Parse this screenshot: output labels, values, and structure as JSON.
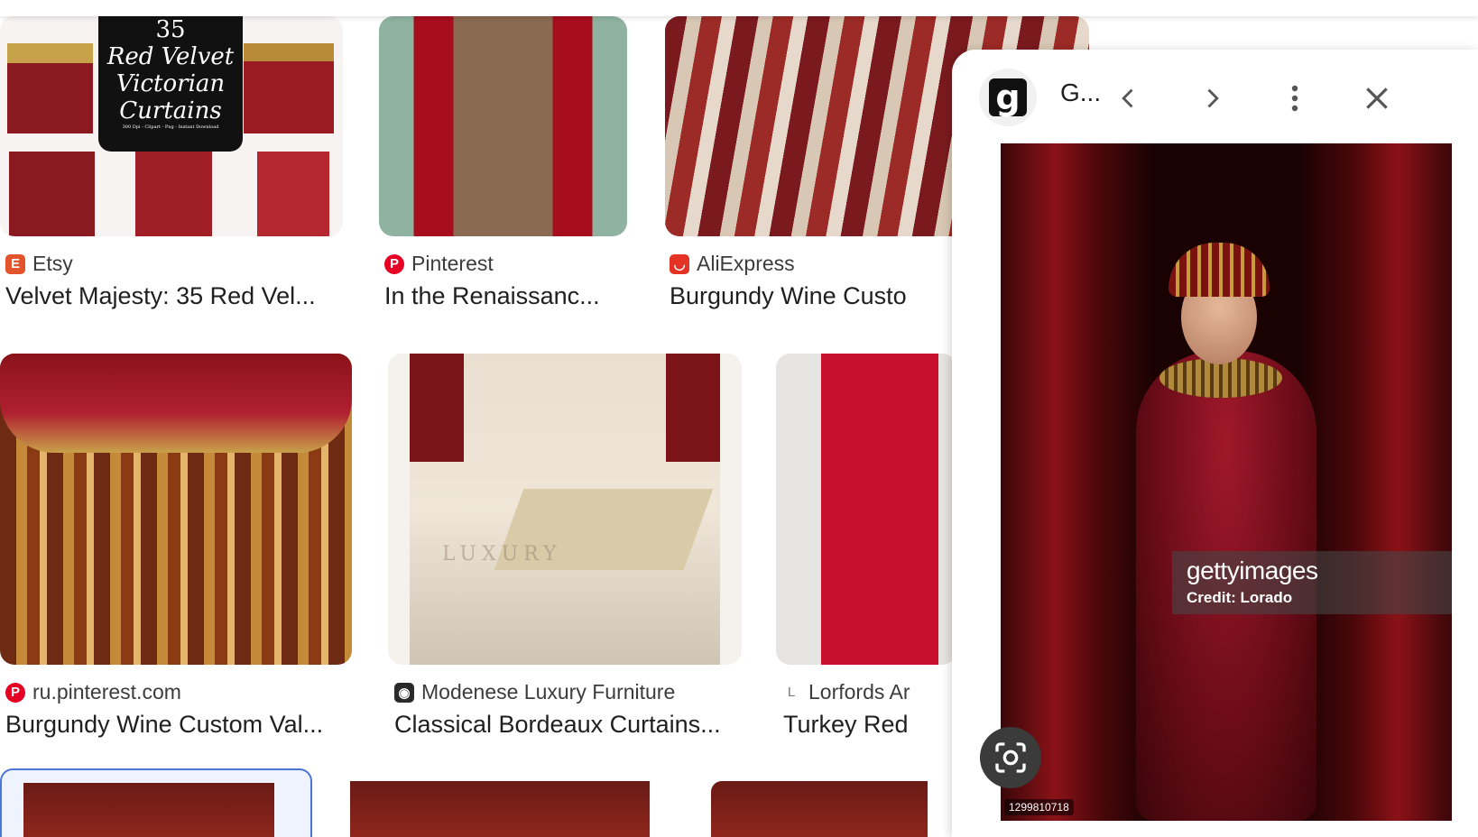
{
  "panel": {
    "title": "G...",
    "image_watermark": "gettyimages",
    "image_credit": "Credit: Lorado",
    "image_id": "1299810718"
  },
  "results": [
    {
      "source": "Etsy",
      "title": "Velvet Majesty: 35 Red Vel...",
      "image_text": [
        "35",
        "Red Velvet",
        "Victorian",
        "Curtains",
        "300 Dpi - Clipart - Png - Instant Download"
      ],
      "favicon_color": "#e2542b"
    },
    {
      "source": "Pinterest",
      "title": "In the Renaissanc...",
      "favicon_color": "#e60023"
    },
    {
      "source": "AliExpress",
      "title": "Burgundy Wine Custo",
      "favicon_color": "#e43225"
    },
    {
      "source": "ru.pinterest.com",
      "title": "Burgundy Wine Custom Val...",
      "favicon_color": "#e60023"
    },
    {
      "source": "Modenese Luxury Furniture",
      "title": "Classical Bordeaux Curtains...",
      "image_text": "LUXURY",
      "favicon_color": "#2a2a2a"
    },
    {
      "source": "Lorfords Ar",
      "title": "Turkey Red",
      "favicon_letter": "L",
      "favicon_color": "#777777"
    }
  ]
}
